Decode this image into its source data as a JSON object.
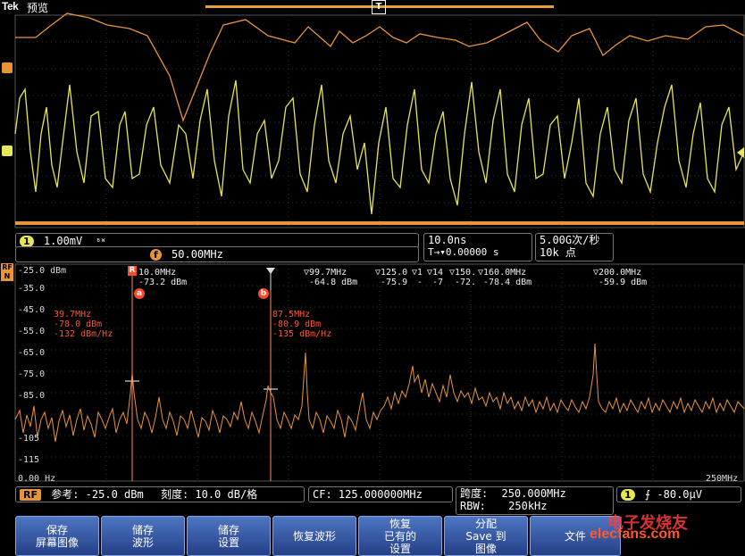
{
  "header": {
    "brand": "Tek",
    "mode": "预览",
    "trigger_marker": "T"
  },
  "time_domain": {
    "channel1": {
      "label": "1",
      "scale": "1.00mV",
      "bw_icon": "bandwidth-icon"
    },
    "math": {
      "label": "f",
      "freq": "50.00MHz"
    },
    "timebase": {
      "scale": "10.0ns",
      "trig_pos": "T→▾0.00000 s"
    },
    "acquisition": {
      "rate": "5.00G次/秒",
      "points": "10k 点"
    }
  },
  "rf": {
    "side_label_top": "RF",
    "side_label_bot": "N",
    "y_labels": [
      "-25.0 dBm",
      "-35.0",
      "-45.0",
      "-55.0",
      "-65.0",
      "-75.0",
      "-85.0",
      "-95",
      "-105",
      "-115",
      "-125"
    ],
    "x_start": "0.00 Hz",
    "x_end": "250MHz",
    "markers_top": [
      {
        "freq": "10.0MHz",
        "level": "-73.2 dBm",
        "ref": "R"
      },
      {
        "freq": "▽99.7MHz",
        "level": "-64.8 dBm"
      },
      {
        "freq": "▽125.0",
        "level": "-75.9"
      },
      {
        "freq": "▽1",
        "level": "-"
      },
      {
        "freq": "▽14",
        "level": "-7"
      },
      {
        "freq": "▽150.",
        "level": "-72."
      },
      {
        "freq": "▽160.0MHz",
        "level": "-78.4 dBm"
      },
      {
        "freq": "▽200.0MHz",
        "level": "-59.9 dBm"
      }
    ],
    "cursor_a": {
      "tag": "a",
      "freq": "39.7MHz",
      "level": "-78.0 dBm",
      "density": "-132 dBm/Hz"
    },
    "cursor_b": {
      "tag": "b",
      "freq": "87.5MHz",
      "level": "-80.9 dBm",
      "density": "-135 dBm/Hz"
    },
    "bottom": {
      "rf_label": "RF",
      "ref_level": "参考: -25.0 dBm",
      "scale": "刻度: 10.0 dB/格",
      "cf": "CF: 125.000000MHz",
      "span_label": "跨度:",
      "span": "250.000MHz",
      "rbw_label": "RBW:",
      "rbw": "250kHz",
      "trig_ch": "1",
      "trig_level": "-80.0μV"
    }
  },
  "softkeys": [
    "保存\n屏幕图像",
    "储存\n波形",
    "储存\n设置",
    "恢复波形",
    "恢复\n已有的\n设置",
    "分配\nSave 到\n图像",
    "文件"
  ],
  "watermark": {
    "line1": "电子发烧友",
    "line2": "elecfans.com"
  },
  "colors": {
    "orange": "#e8953a",
    "yellow": "#e6e658",
    "grid": "#3a3a3a",
    "accent_blue": "#3c5fb0"
  }
}
